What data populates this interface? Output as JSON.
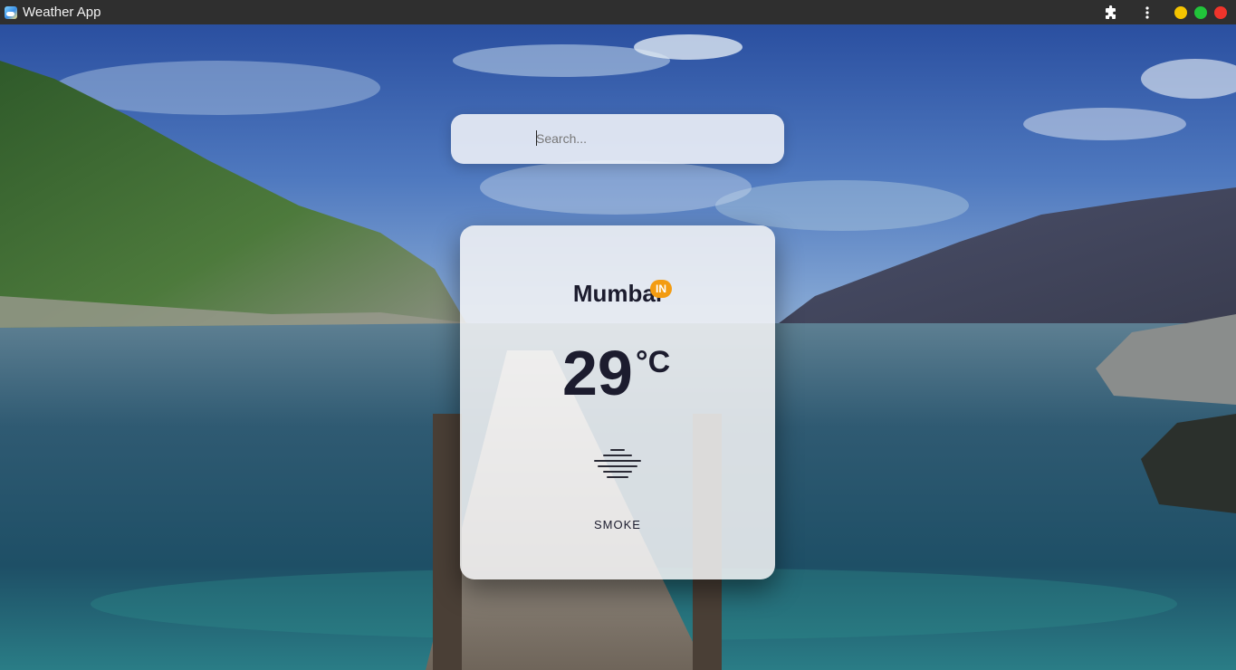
{
  "window": {
    "title": "Weather App",
    "controls": {
      "extensions_icon": "puzzle-icon",
      "menu_icon": "kebab-menu-icon",
      "minimize_color": "#f5c400",
      "maximize_color": "#21c43a",
      "close_color": "#f0342b"
    }
  },
  "search": {
    "placeholder": "Search...",
    "value": ""
  },
  "weather": {
    "city": "Mumbai",
    "country": "IN",
    "temperature": "29",
    "unit": "°C",
    "condition": "SMOKE",
    "condition_icon": "smoke-haze-icon"
  },
  "colors": {
    "badge": "#f39c12",
    "text": "#1c1c2e"
  }
}
